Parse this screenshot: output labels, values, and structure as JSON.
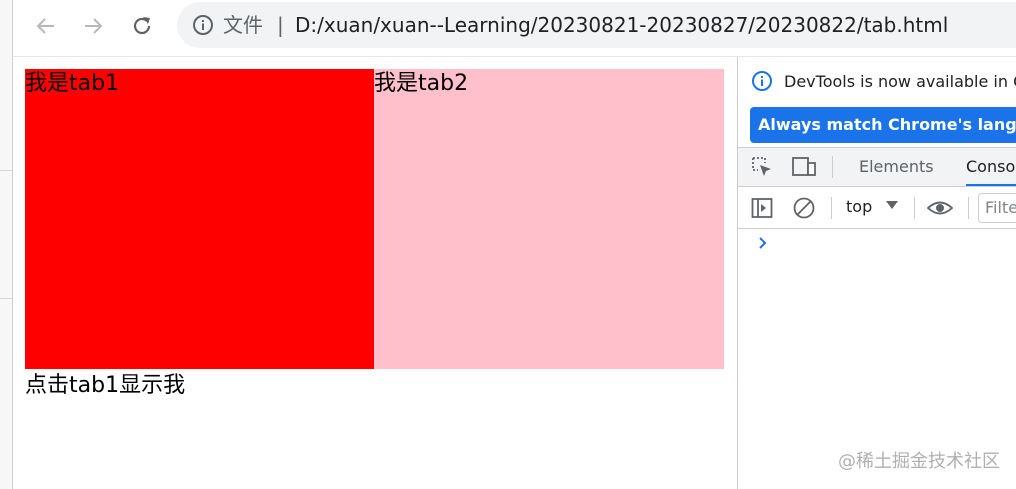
{
  "toolbar": {
    "back_icon": "arrow-left-icon",
    "forward_icon": "arrow-right-icon",
    "reload_icon": "reload-icon",
    "info_icon": "info-icon",
    "file_label": "文件",
    "separator": "|",
    "url": "D:/xuan/xuan--Learning/20230821-20230827/20230822/tab.html"
  },
  "page": {
    "tab1_text": "我是tab1",
    "tab2_text": "我是tab2",
    "content_text": "点击tab1显示我",
    "colors": {
      "tab1": "#ff0000",
      "tab2": "#ffc0cb"
    }
  },
  "devtools": {
    "notice_text": "DevTools is now available in C",
    "lang_button": "Always match Chrome's languag",
    "tabs": [
      {
        "label": "Elements",
        "active": false
      },
      {
        "label": "Conso",
        "active": true
      }
    ],
    "context": "top",
    "filter_placeholder": "Filte",
    "accent": "#1a73e8"
  },
  "watermark": "@稀土掘金技术社区"
}
